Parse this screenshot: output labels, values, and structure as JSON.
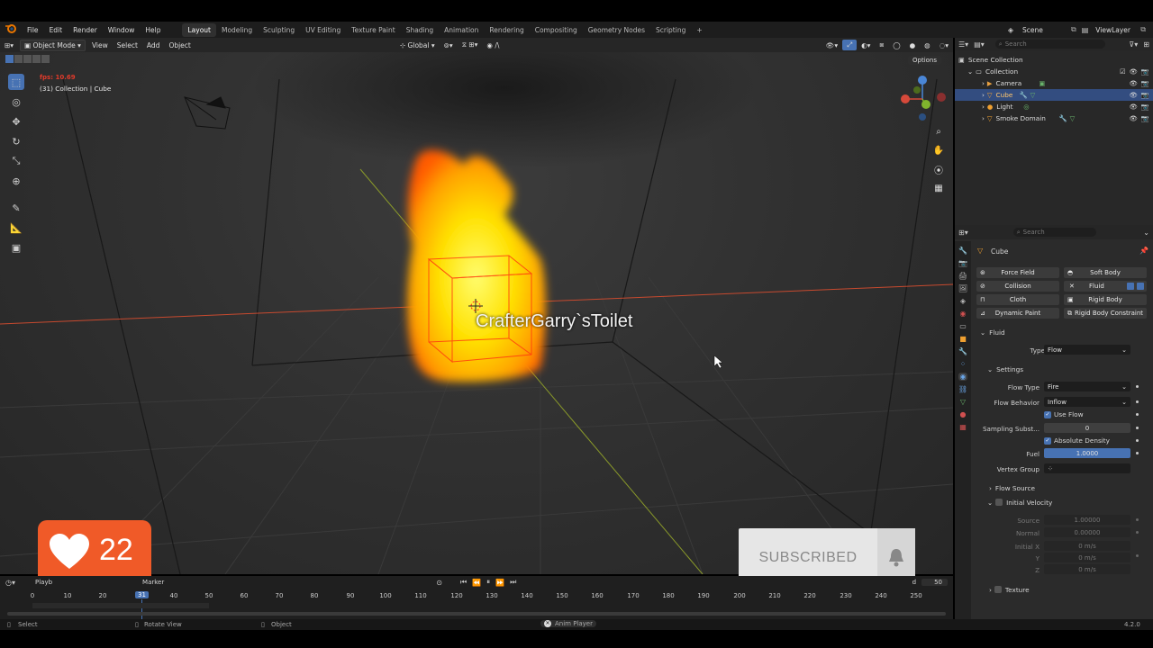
{
  "app": {
    "logo": "blender-logo-icon"
  },
  "menus": [
    "File",
    "Edit",
    "Render",
    "Window",
    "Help"
  ],
  "workspaces": [
    "Layout",
    "Modeling",
    "Sculpting",
    "UV Editing",
    "Texture Paint",
    "Shading",
    "Animation",
    "Rendering",
    "Compositing",
    "Geometry Nodes",
    "Scripting",
    "+"
  ],
  "scene": {
    "label": "Scene",
    "view_layer": "ViewLayer"
  },
  "viewport_header": {
    "mode": "Object Mode",
    "view": "View",
    "select": "Select",
    "add": "Add",
    "object": "Object",
    "orientation": "Global",
    "options": "Options"
  },
  "viewport": {
    "fps": "fps: 10.69",
    "collection_info": "(31) Collection | Cube",
    "watermark": "CrafterGarry`sToilet"
  },
  "overlay_like": {
    "count": "22"
  },
  "overlay_subscribed": {
    "label": "SUBSCRIBED"
  },
  "outliner": {
    "search_placeholder": "Search",
    "rows": [
      {
        "label": "Scene Collection"
      },
      {
        "label": "Collection"
      },
      {
        "label": "Camera"
      },
      {
        "label": "Cube"
      },
      {
        "label": "Light"
      },
      {
        "label": "Smoke Domain"
      }
    ]
  },
  "properties": {
    "search_placeholder": "Search",
    "object_name": "Cube",
    "physics_buttons": [
      {
        "label": "Force Field"
      },
      {
        "label": "Soft Body"
      },
      {
        "label": "Collision"
      },
      {
        "label": "Fluid"
      },
      {
        "label": "Cloth"
      },
      {
        "label": "Rigid Body"
      },
      {
        "label": "Dynamic Paint"
      },
      {
        "label": "Rigid Body Constraint"
      }
    ],
    "fluid_panel": "Fluid",
    "type_label": "Type",
    "type_value": "Flow",
    "settings_panel": "Settings",
    "flow_type_label": "Flow Type",
    "flow_type_value": "Fire",
    "flow_behavior_label": "Flow Behavior",
    "flow_behavior_value": "Inflow",
    "use_flow_label": "Use Flow",
    "sampling_label": "Sampling Subst...",
    "sampling_value": "0",
    "absolute_density_label": "Absolute Density",
    "fuel_label": "Fuel",
    "fuel_value": "1.0000",
    "vertex_group_label": "Vertex Group",
    "flow_source_panel": "Flow Source",
    "initial_velocity_panel": "Initial Velocity",
    "source_label": "Source",
    "source_value": "1.00000",
    "normal_label": "Normal",
    "normal_value": "0.00000",
    "initial_x_label": "Initial X",
    "initial_x_value": "0 m/s",
    "y_label": "Y",
    "y_value": "0 m/s",
    "z_label": "Z",
    "z_value": "0 m/s",
    "texture_panel": "Texture"
  },
  "timeline": {
    "playback": "Playb",
    "marker": "Marker",
    "current_frame": "31",
    "end_label": "d",
    "end_frame": "50",
    "ticks": [
      "0",
      "10",
      "20",
      "40",
      "50",
      "60",
      "70",
      "80",
      "90",
      "100",
      "110",
      "120",
      "130",
      "140",
      "150",
      "160",
      "170",
      "180",
      "190",
      "200",
      "210",
      "220",
      "230",
      "240",
      "250"
    ]
  },
  "statusbar": {
    "select": "Select",
    "rotate": "Rotate View",
    "object": "Object",
    "anim_player": "Anim Player",
    "version": "4.2.0"
  },
  "colors": {
    "accent": "#4772b3",
    "selected_row": "#334d80",
    "fire_core": "#ffe100",
    "fire_edge": "#ff5a00",
    "x_axis": "#c84a2f",
    "y_axis": "#8a9a2a",
    "like_badge": "#f05a28"
  }
}
